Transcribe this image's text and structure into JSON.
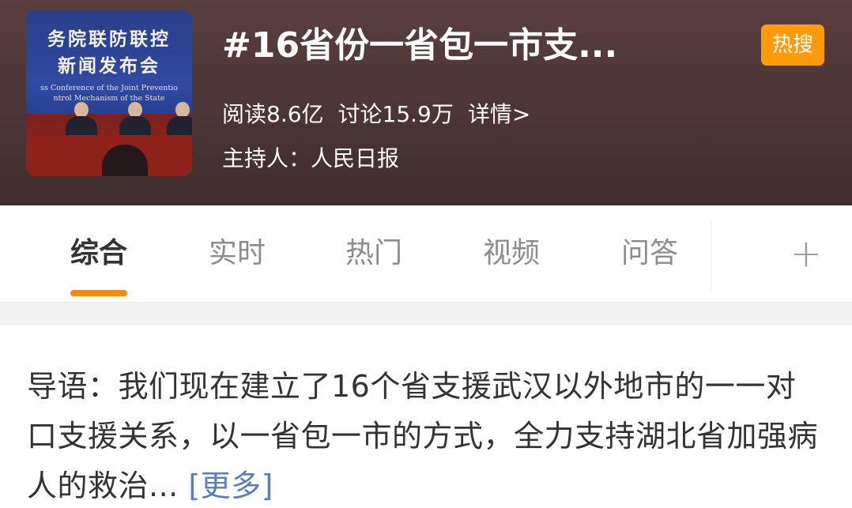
{
  "header": {
    "cover": {
      "title_line1": "务院联防联控",
      "title_line2": "新闻发布会",
      "subtitle_line1": "ss Conference of the Joint Preventio",
      "subtitle_line2": "ntrol Mechanism of the State"
    },
    "topic_title": "#16省份一省包一市支...",
    "badge": "热搜",
    "stats": {
      "reads": "阅读8.6亿",
      "discussions": "讨论15.9万",
      "details": "详情>"
    },
    "host": "主持人：人民日报",
    "colors": {
      "badge": "#ff9b0a",
      "header_bg": "#4b3536"
    }
  },
  "tabs": [
    {
      "label": "综合",
      "active": true
    },
    {
      "label": "实时",
      "active": false
    },
    {
      "label": "热门",
      "active": false
    },
    {
      "label": "视频",
      "active": false
    },
    {
      "label": "问答",
      "active": false
    }
  ],
  "tab_plus": "+",
  "accent_color": "#ff8a00",
  "intro": {
    "text": "导语：我们现在建立了16个省支援武汉以外地市的一一对口支援关系，以一省包一市的方式，全力支持湖北省加强病人的救治...",
    "more": "[更多]"
  }
}
